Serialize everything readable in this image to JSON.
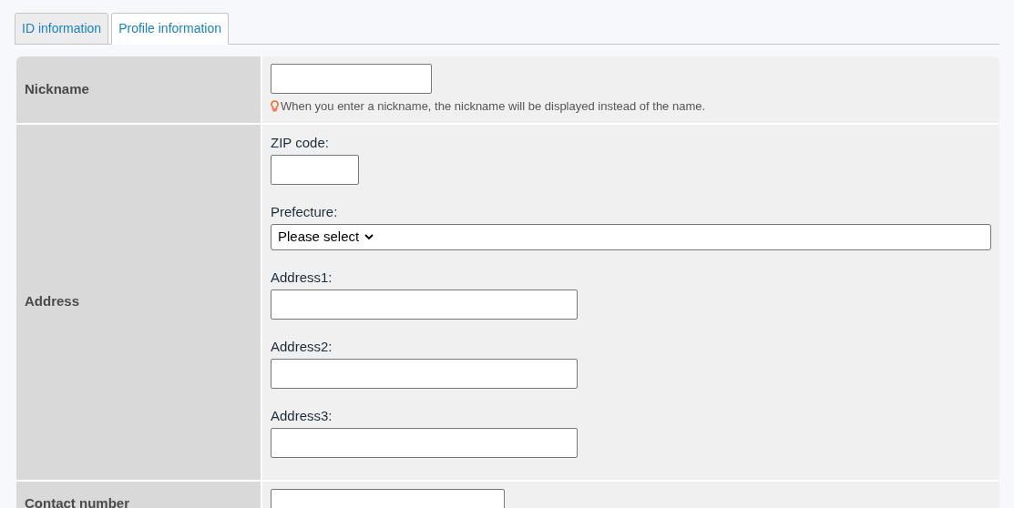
{
  "tabs": [
    {
      "label": "ID information",
      "selected": false
    },
    {
      "label": "Profile information",
      "selected": true
    }
  ],
  "rows": [
    {
      "label": "Nickname",
      "fields": [
        {
          "kind": "text"
        }
      ],
      "hint": "When you enter a nickname, the nickname will be displayed instead of the name."
    },
    {
      "label": "Address",
      "fields": [
        {
          "kind": "zip",
          "label": "ZIP code:"
        },
        {
          "kind": "select",
          "label": "Prefecture:",
          "value": "Please select"
        },
        {
          "kind": "address",
          "label": "Address1:"
        },
        {
          "kind": "address",
          "label": "Address2:"
        },
        {
          "kind": "address",
          "label": "Address3:"
        }
      ]
    },
    {
      "label": "Contact number",
      "fields": [
        {
          "kind": "tel"
        }
      ]
    }
  ]
}
